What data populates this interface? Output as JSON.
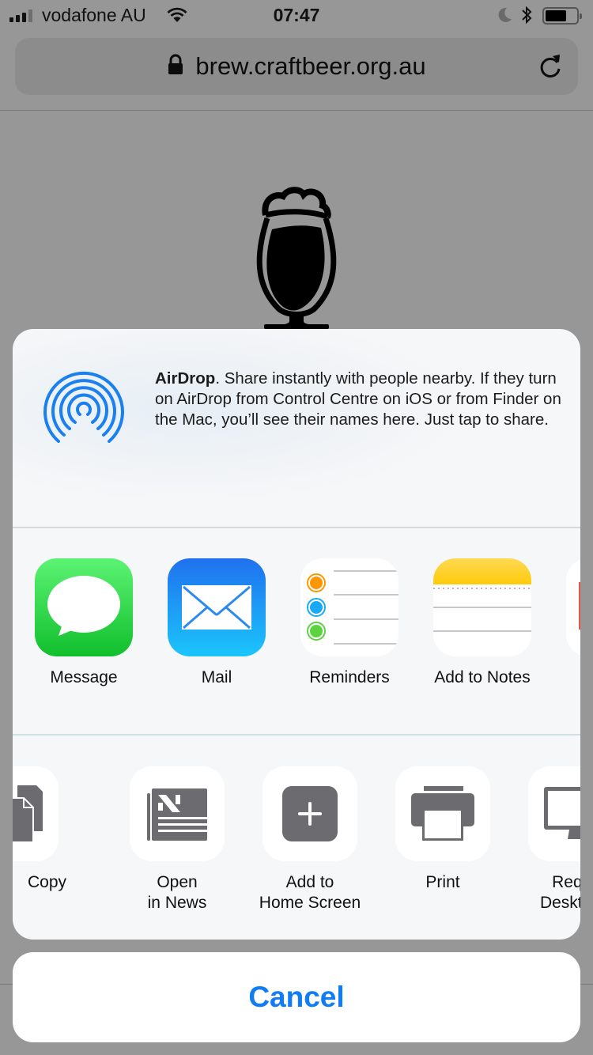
{
  "status_bar": {
    "carrier": "vodafone AU",
    "time": "07:47",
    "icons": [
      "signal-icon",
      "wifi-icon",
      "do-not-disturb-moon-icon",
      "bluetooth-icon",
      "battery-icon"
    ]
  },
  "browser": {
    "url": "brew.craftbeer.org.au",
    "secure_icon": "lock-icon",
    "reload_icon": "reload-icon"
  },
  "page": {
    "logo": "beer-glass-logo"
  },
  "share_sheet": {
    "airdrop": {
      "title": "AirDrop",
      "description": ". Share instantly with people nearby. If they turn on AirDrop from Control Centre on iOS or from Finder on the Mac, you’ll see their names here. Just tap to share."
    },
    "apps": [
      {
        "label": "Message",
        "icon": "messages-icon"
      },
      {
        "label": "Mail",
        "icon": "mail-icon"
      },
      {
        "label": "Reminders",
        "icon": "reminders-icon"
      },
      {
        "label": "Add to Notes",
        "icon": "notes-icon"
      }
    ],
    "actions": [
      {
        "label": "Copy",
        "icon": "copy-icon"
      },
      {
        "label": "Open\nin News",
        "line1": "Open",
        "line2": "in News",
        "icon": "news-icon"
      },
      {
        "label": "Add to Home Screen",
        "line1": "Add to",
        "line2": "Home Screen",
        "icon": "add-to-home-screen-icon"
      },
      {
        "label": "Print",
        "icon": "print-icon"
      },
      {
        "label": "Request Desktop Site",
        "line1": "Reque",
        "line2": "Desktop",
        "icon": "desktop-icon"
      }
    ],
    "colors": {
      "airdrop_blue": "#1a80f0",
      "cancel_blue": "#107cf5",
      "action_glyph_gray": "#6b6b70",
      "messages_green": "#2ad144",
      "notes_yellow": "#fecb09"
    }
  },
  "cancel_label": "Cancel"
}
